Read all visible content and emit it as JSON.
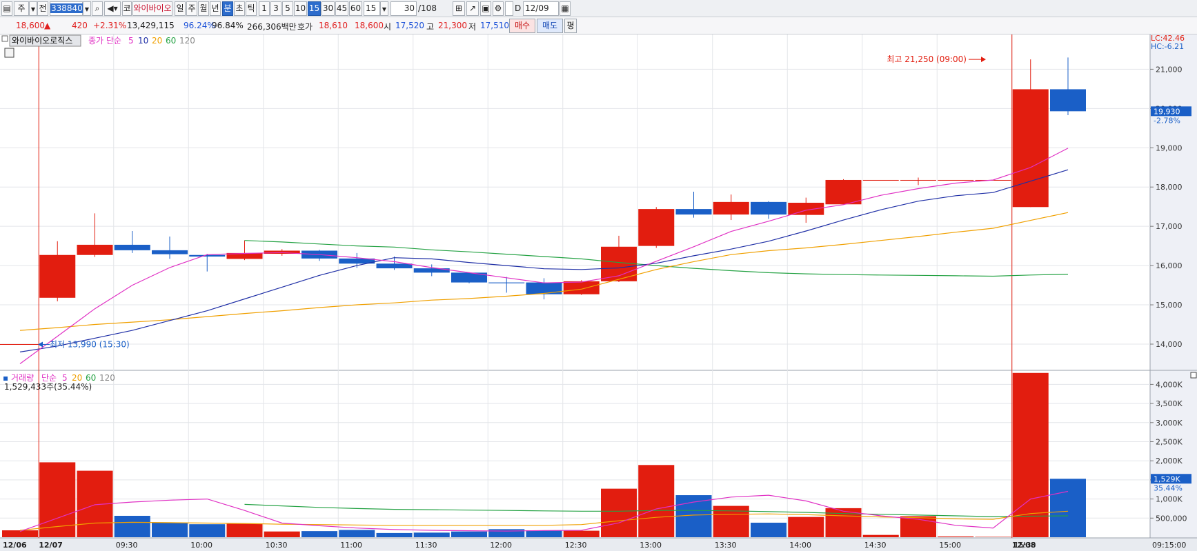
{
  "toolbar": {
    "market_tab": "주",
    "prev_label": "전",
    "stock_code": "338840",
    "market_badge": "코",
    "stock_name": "와이바이오",
    "periods": [
      "일",
      "주",
      "월",
      "년",
      "분",
      "초",
      "틱"
    ],
    "active_period": "분",
    "intervals": [
      "1",
      "3",
      "5",
      "10",
      "15",
      "30",
      "45",
      "60"
    ],
    "active_interval": "15",
    "interval_select": "15",
    "count": "30",
    "count_total": "/108",
    "d_label": "D",
    "date": "12/09"
  },
  "quote": {
    "price": "18,600",
    "change_arrow": "▲",
    "change": "420",
    "change_pct": "+2.31%",
    "volume": "13,429,115",
    "ratio1": "96.24%",
    "ratio2": "96.84%",
    "amount": "266,306백만",
    "hoga_label": "호가",
    "ask": "18,610",
    "bid": "18,600",
    "open_label": "시",
    "open": "17,520",
    "high_label": "고",
    "high": "21,300",
    "low_label": "저",
    "low": "17,510",
    "buy_label": "매수",
    "sell_label": "매도",
    "avg_label": "평"
  },
  "colors": {
    "up": "#e21d0f",
    "down": "#1a5fc7",
    "ma5": "#e031c4",
    "ma10": "#1f2fa6",
    "ma20": "#f0a000",
    "ma60": "#25a244",
    "ma120": "#888888"
  },
  "price_panel": {
    "stock_tag": "와이바이오로직스",
    "legend_title": "종가 단순",
    "legend_periods": [
      "5",
      "10",
      "20",
      "60",
      "120"
    ],
    "lc_label": "LC:42.46",
    "hc_label": "HC:-6.21",
    "current_price_tag": "19,930",
    "current_pct_tag": "-2.78%",
    "high_annotation": "최고 21,250 (09:00)",
    "low_annotation": "최저 13,990 (15:30)"
  },
  "volume_panel": {
    "legend_title": "거래량",
    "legend_ma": "단순",
    "legend_periods": [
      "5",
      "20",
      "60",
      "120"
    ],
    "info": "1,529,433주(35.44%)",
    "current_tag": "1,529K",
    "current_pct": "35.44%"
  },
  "time_axis": [
    "12/06",
    "12/07",
    "09:30",
    "10:00",
    "10:30",
    "11:00",
    "11:30",
    "12:00",
    "12:30",
    "13:00",
    "13:30",
    "14:00",
    "14:30",
    "15:00",
    "15:30",
    "12/08",
    "09:15:00"
  ],
  "chart_data": {
    "type": "candlestick",
    "y_axis_price": {
      "ticks": [
        14000,
        15000,
        16000,
        17000,
        18000,
        19000,
        20000,
        21000
      ],
      "tick_labels": [
        "14,000",
        "15,000",
        "16,000",
        "17,000",
        "18,000",
        "19,000",
        "20,000",
        "21,000"
      ],
      "range": [
        13350,
        21850
      ]
    },
    "y_axis_volume": {
      "ticks": [
        500000,
        1000000,
        1500000,
        2000000,
        2500000,
        3000000,
        3500000,
        4000000
      ],
      "tick_labels": [
        "500,000",
        "1,000K",
        "1,500K",
        "2,000K",
        "2,500K",
        "3,000K",
        "3,500K",
        "4,000K"
      ],
      "range": [
        0,
        4350000
      ]
    },
    "candles": [
      {
        "o": 13990,
        "h": 14000,
        "l": 13990,
        "c": 14000,
        "v": 180000
      },
      {
        "o": 15180,
        "h": 16620,
        "l": 15090,
        "c": 16270,
        "v": 1960000
      },
      {
        "o": 16270,
        "h": 17330,
        "l": 16220,
        "c": 16530,
        "v": 1740000
      },
      {
        "o": 16530,
        "h": 16880,
        "l": 16320,
        "c": 16390,
        "v": 560000
      },
      {
        "o": 16390,
        "h": 16740,
        "l": 16170,
        "c": 16290,
        "v": 380000
      },
      {
        "o": 16270,
        "h": 16300,
        "l": 15850,
        "c": 16230,
        "v": 340000
      },
      {
        "o": 16170,
        "h": 16640,
        "l": 16140,
        "c": 16320,
        "v": 350000
      },
      {
        "o": 16300,
        "h": 16420,
        "l": 16250,
        "c": 16380,
        "v": 150000
      },
      {
        "o": 16380,
        "h": 16400,
        "l": 16120,
        "c": 16180,
        "v": 160000
      },
      {
        "o": 16180,
        "h": 16320,
        "l": 15940,
        "c": 16050,
        "v": 190000
      },
      {
        "o": 16050,
        "h": 16230,
        "l": 15890,
        "c": 15930,
        "v": 110000
      },
      {
        "o": 15930,
        "h": 16030,
        "l": 15730,
        "c": 15820,
        "v": 120000
      },
      {
        "o": 15820,
        "h": 15830,
        "l": 15550,
        "c": 15570,
        "v": 150000
      },
      {
        "o": 15570,
        "h": 15710,
        "l": 15310,
        "c": 15550,
        "v": 210000
      },
      {
        "o": 15570,
        "h": 15680,
        "l": 15140,
        "c": 15270,
        "v": 180000
      },
      {
        "o": 15270,
        "h": 15630,
        "l": 15250,
        "c": 15600,
        "v": 170000
      },
      {
        "o": 15600,
        "h": 16760,
        "l": 15580,
        "c": 16480,
        "v": 1270000
      },
      {
        "o": 16500,
        "h": 17490,
        "l": 16450,
        "c": 17440,
        "v": 1890000
      },
      {
        "o": 17440,
        "h": 17880,
        "l": 17220,
        "c": 17300,
        "v": 1100000
      },
      {
        "o": 17300,
        "h": 17810,
        "l": 17160,
        "c": 17620,
        "v": 820000
      },
      {
        "o": 17620,
        "h": 17640,
        "l": 17190,
        "c": 17300,
        "v": 380000
      },
      {
        "o": 17290,
        "h": 17730,
        "l": 17090,
        "c": 17600,
        "v": 530000
      },
      {
        "o": 17560,
        "h": 18200,
        "l": 17560,
        "c": 18180,
        "v": 760000
      },
      {
        "o": 18180,
        "h": 18180,
        "l": 18180,
        "c": 18180,
        "v": 60000
      },
      {
        "o": 18180,
        "h": 18240,
        "l": 18050,
        "c": 18180,
        "v": 550000
      },
      {
        "o": 18180,
        "h": 18180,
        "l": 18180,
        "c": 18180,
        "v": 20000
      },
      {
        "o": 18180,
        "h": 18180,
        "l": 18180,
        "c": 18180,
        "v": 10000
      },
      {
        "o": 17490,
        "h": 21250,
        "l": 17490,
        "c": 20490,
        "v": 4300000
      },
      {
        "o": 20490,
        "h": 21300,
        "l": 19830,
        "c": 19930,
        "v": 1529433
      }
    ],
    "ma5": [
      13500,
      14200,
      14900,
      15500,
      15950,
      16280,
      16310,
      16330,
      16280,
      16200,
      16100,
      15950,
      15820,
      15690,
      15560,
      15580,
      15740,
      16110,
      16480,
      16870,
      17130,
      17410,
      17550,
      17790,
      17960,
      18100,
      18180,
      18500,
      18990
    ],
    "ma10": [
      13800,
      13950,
      14150,
      14350,
      14600,
      14850,
      15150,
      15450,
      15750,
      16000,
      16200,
      16170,
      16080,
      16000,
      15920,
      15900,
      15940,
      16060,
      16250,
      16420,
      16620,
      16880,
      17160,
      17420,
      17640,
      17780,
      17860,
      18150,
      18440
    ],
    "ma20": [
      14350,
      14420,
      14500,
      14560,
      14620,
      14700,
      14780,
      14850,
      14930,
      15000,
      15050,
      15120,
      15160,
      15220,
      15290,
      15400,
      15650,
      15900,
      16100,
      16280,
      16380,
      16450,
      16540,
      16640,
      16740,
      16850,
      16950,
      17150,
      17350
    ],
    "ma60": [
      null,
      null,
      null,
      null,
      null,
      null,
      16640,
      16600,
      16550,
      16500,
      16470,
      16400,
      16350,
      16290,
      16230,
      16170,
      16080,
      16000,
      15930,
      15870,
      15820,
      15790,
      15770,
      15760,
      15750,
      15740,
      15730,
      15760,
      15780
    ],
    "vma5": [
      150000,
      500000,
      850000,
      920000,
      970000,
      1000000,
      700000,
      370000,
      300000,
      240000,
      200000,
      180000,
      170000,
      160000,
      175000,
      180000,
      375000,
      740000,
      920000,
      1050000,
      1100000,
      950000,
      680000,
      560000,
      470000,
      310000,
      240000,
      1000000,
      1200000
    ],
    "vma20": [
      180000,
      280000,
      370000,
      390000,
      380000,
      370000,
      360000,
      340000,
      330000,
      320000,
      310000,
      310000,
      310000,
      310000,
      310000,
      330000,
      430000,
      520000,
      580000,
      600000,
      610000,
      590000,
      560000,
      530000,
      510000,
      480000,
      470000,
      620000,
      680000
    ],
    "vma60": [
      null,
      null,
      null,
      null,
      null,
      null,
      860000,
      820000,
      780000,
      750000,
      730000,
      720000,
      710000,
      700000,
      690000,
      680000,
      680000,
      700000,
      700000,
      690000,
      670000,
      650000,
      620000,
      600000,
      580000,
      560000,
      540000,
      550000,
      560000
    ]
  }
}
